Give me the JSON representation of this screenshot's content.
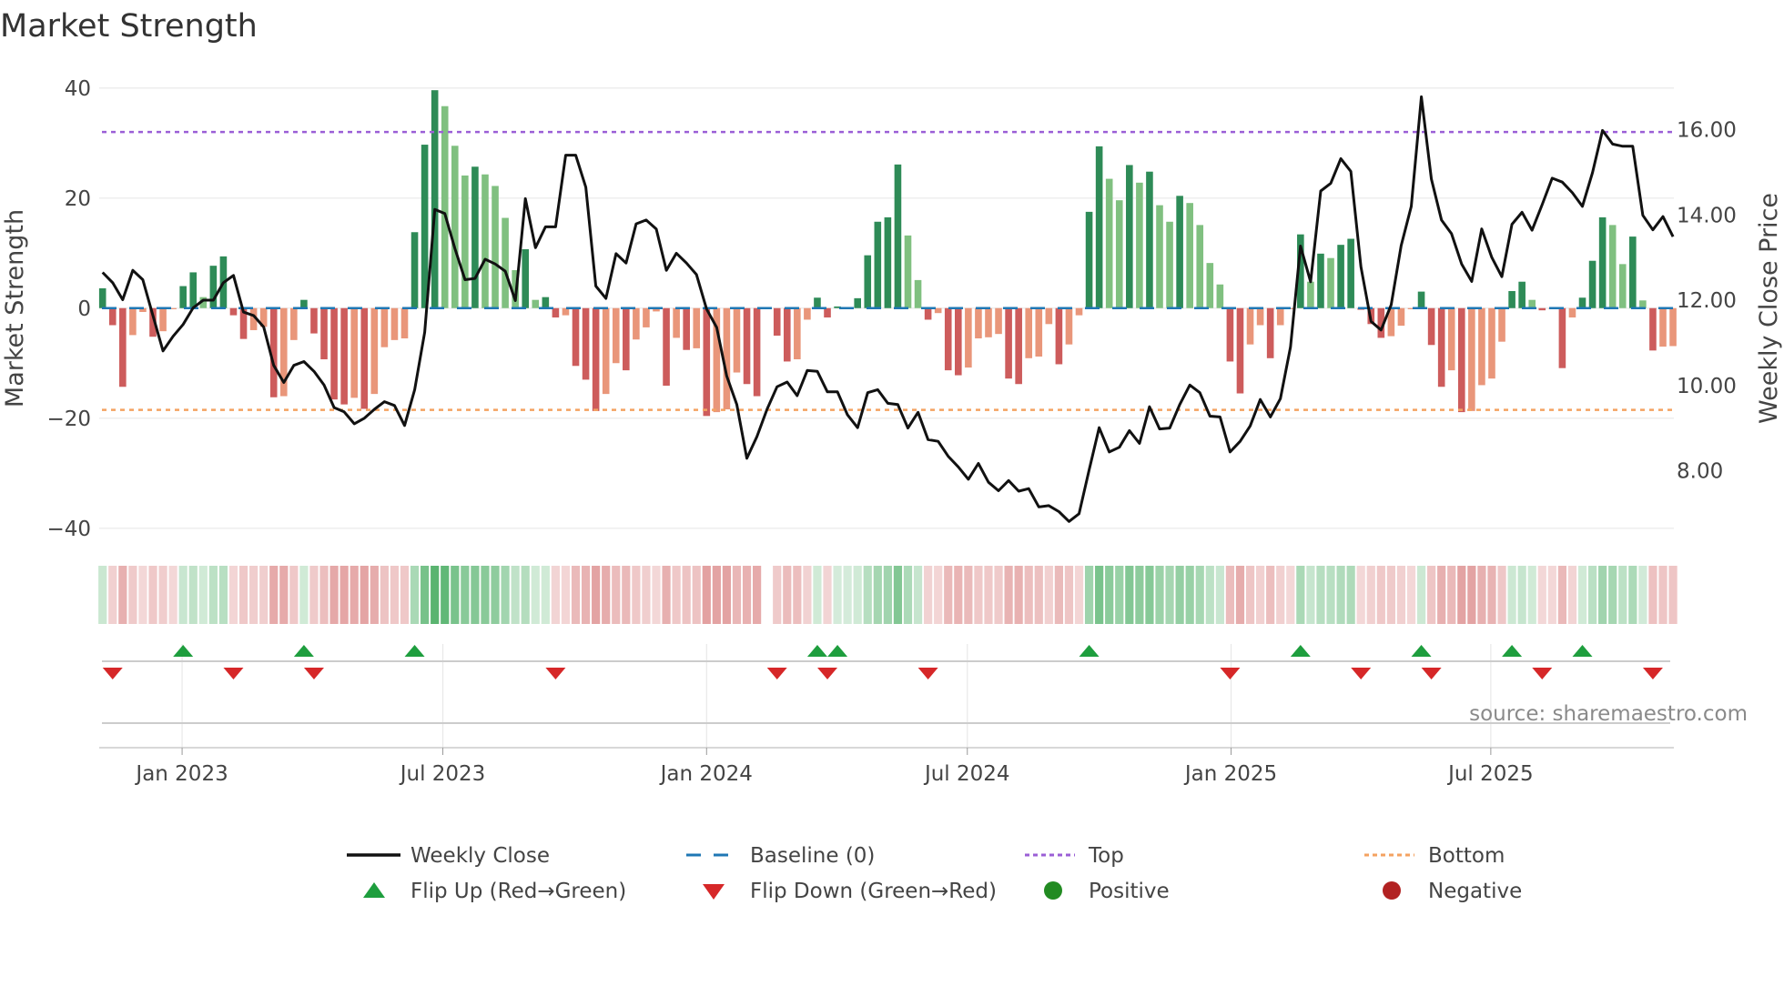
{
  "chart_data": {
    "type": "bar",
    "title": "Market Strength",
    "ylabel": "Market Strength",
    "ylabel_right": "Weekly Close Price",
    "ylim": [
      -42,
      42
    ],
    "ylim_right": [
      6.2,
      17.2
    ],
    "yticks": [
      "40",
      "20",
      "0",
      "−20",
      "−40"
    ],
    "ytick_values": [
      40,
      20,
      0,
      -20,
      -40
    ],
    "yticks_right": [
      "16.00",
      "14.00",
      "12.00",
      "10.00",
      "8.00"
    ],
    "ytick_right_values": [
      16,
      14,
      12,
      10,
      8
    ],
    "xtick_labels": [
      "Jan 2023",
      "Jul 2023",
      "Jan 2024",
      "Jul 2024",
      "Jan 2025",
      "Jul 2025"
    ],
    "xtick_weeks": [
      7.9,
      33.8,
      60.0,
      85.9,
      112.1,
      137.9
    ],
    "top_level": 32,
    "bottom_level": -18.5,
    "baseline": 0,
    "grid": true,
    "legend_position": "bottom",
    "source": "source: sharemaestro.com",
    "legend": {
      "weekly_close": "Weekly Close",
      "baseline": "Baseline (0)",
      "top": "Top",
      "bottom": "Bottom",
      "flip_up": "Flip Up (Red→Green)",
      "flip_down": "Flip Down (Green→Red)",
      "positive": "Positive",
      "negative": "Negative"
    },
    "series": [
      {
        "name": "Market Strength",
        "values": [
          3.6,
          -3.1,
          -14.3,
          -4.9,
          -0.7,
          -5.2,
          -4.2,
          -0.2,
          4.0,
          6.5,
          2.0,
          7.7,
          9.4,
          -1.3,
          -5.6,
          -4.0,
          -3.4,
          -16.2,
          -16.0,
          -5.8,
          1.5,
          -4.6,
          -9.3,
          -16.6,
          -17.5,
          -16.3,
          -18.3,
          -15.6,
          -7.1,
          -5.8,
          -5.5,
          13.8,
          29.7,
          39.6,
          36.7,
          29.5,
          24.1,
          25.7,
          24.3,
          22.2,
          16.4,
          6.9,
          10.7,
          1.5,
          2.0,
          -1.7,
          -1.3,
          -10.5,
          -13.0,
          -18.7,
          -15.6,
          -10.0,
          -11.3,
          -5.7,
          -3.5,
          -0.6,
          -14.1,
          -5.4,
          -7.6,
          -7.3,
          -19.6,
          -18.9,
          -18.4,
          -11.7,
          -13.8,
          -16.0,
          0,
          -5.0,
          -9.7,
          -9.3,
          -2.1,
          1.9,
          -1.7,
          0.3,
          0.2,
          1.8,
          9.6,
          15.7,
          16.5,
          26.1,
          13.2,
          5.1,
          -2.1,
          -0.9,
          -11.3,
          -12.2,
          -10.8,
          -5.5,
          -5.3,
          -4.7,
          -12.8,
          -13.8,
          -9.1,
          -8.8,
          -2.9,
          -10.2,
          -6.6,
          -1.3,
          17.5,
          29.4,
          23.5,
          19.6,
          26.0,
          22.8,
          24.8,
          18.7,
          15.7,
          20.4,
          19.1,
          15.1,
          8.2,
          4.3,
          -9.7,
          -15.5,
          -6.6,
          -3.1,
          -9.1,
          -3.1,
          -0.2,
          13.4,
          4.8,
          9.9,
          9.1,
          11.5,
          12.6,
          -0.3,
          -2.9,
          -5.4,
          -5.1,
          -3.2,
          -0.2,
          3.0,
          -6.7,
          -14.3,
          -11.3,
          -18.9,
          -18.7,
          -14.0,
          -12.8,
          -6.1,
          3.1,
          4.8,
          1.5,
          -0.4,
          -0.2,
          -10.9,
          -1.7,
          1.9,
          8.6,
          16.5,
          15.1,
          8.0,
          13.0,
          1.4,
          -7.7,
          -7.0,
          -6.9
        ]
      },
      {
        "name": "Weekly Close",
        "axis": "right",
        "values": [
          12.65,
          12.41,
          12.01,
          12.7,
          12.48,
          11.64,
          10.81,
          11.15,
          11.43,
          11.82,
          12.0,
          12.0,
          12.41,
          12.58,
          11.72,
          11.64,
          11.37,
          10.47,
          10.07,
          10.47,
          10.56,
          10.33,
          10.01,
          9.48,
          9.38,
          9.1,
          9.23,
          9.44,
          9.62,
          9.53,
          9.06,
          9.9,
          11.25,
          14.13,
          14.03,
          13.21,
          12.48,
          12.51,
          12.96,
          12.85,
          12.68,
          11.99,
          14.38,
          13.23,
          13.72,
          13.72,
          15.4,
          15.4,
          14.65,
          12.33,
          12.04,
          13.09,
          12.87,
          13.79,
          13.88,
          13.67,
          12.7,
          13.1,
          12.87,
          12.6,
          11.79,
          11.36,
          10.22,
          9.55,
          8.29,
          8.8,
          9.44,
          9.97,
          10.08,
          9.76,
          10.35,
          10.33,
          9.85,
          9.85,
          9.31,
          9.01,
          9.83,
          9.9,
          9.58,
          9.55,
          9.0,
          9.37,
          8.73,
          8.69,
          8.34,
          8.09,
          7.8,
          8.17,
          7.73,
          7.53,
          7.77,
          7.52,
          7.58,
          7.15,
          7.18,
          7.04,
          6.81,
          6.99,
          8.02,
          9.01,
          8.44,
          8.55,
          8.94,
          8.64,
          9.5,
          8.98,
          9.0,
          9.55,
          10.01,
          9.83,
          9.28,
          9.26,
          8.44,
          8.69,
          9.05,
          9.67,
          9.26,
          9.69,
          10.9,
          13.27,
          12.43,
          14.56,
          14.74,
          15.32,
          15.02,
          12.78,
          11.5,
          11.3,
          11.89,
          13.28,
          14.2,
          16.77,
          14.84,
          13.88,
          13.56,
          12.85,
          12.44,
          13.67,
          13.0,
          12.55,
          13.78,
          14.06,
          13.64,
          14.24,
          14.86,
          14.77,
          14.52,
          14.2,
          14.99,
          15.98,
          15.66,
          15.61,
          15.61,
          13.99,
          13.65,
          13.96,
          13.49
        ]
      }
    ],
    "colors": {
      "pos_rising": "#2e8b57",
      "pos_falling": "#80c080",
      "neg_falling": "#cd5c5c",
      "neg_rising": "#e9967a",
      "line": "#111111",
      "baseline": "#1f77b4",
      "top": "#9b5fd6",
      "bottom": "#f4a261",
      "flip_up": "#1e9e3e",
      "flip_down": "#d62728",
      "positive": "#228b22",
      "negative": "#b22222"
    }
  }
}
